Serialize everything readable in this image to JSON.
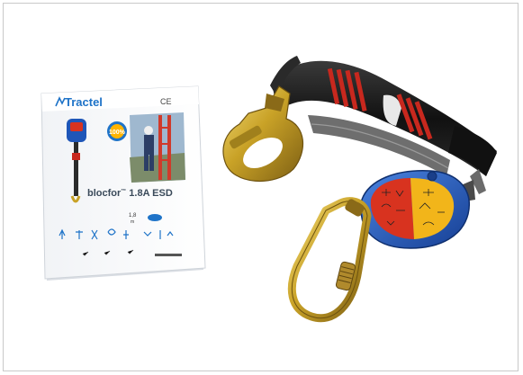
{
  "booklet": {
    "brand": "Tractel",
    "ce_mark": "CE",
    "product_name": "blocfor",
    "trademark": "™",
    "model": "1.8A ESD",
    "badge_text": "100%",
    "size_label": "1,8",
    "size_unit": "m"
  },
  "colors": {
    "background": "#ffffff",
    "frame_border": "#c9c9c9",
    "brand_blue": "#1e73c8",
    "lanyard_black": "#1a1a1a",
    "lanyard_red": "#c8281e",
    "hook_gold": "#c9a227",
    "device_blue": "#1f56b8",
    "device_red": "#d8331f",
    "device_yellow": "#f2b51a",
    "carabiner_gold": "#b8903a"
  },
  "icons": [
    "lanyard-device-icon",
    "climber-photo-icon",
    "pictogram-row-icon"
  ]
}
